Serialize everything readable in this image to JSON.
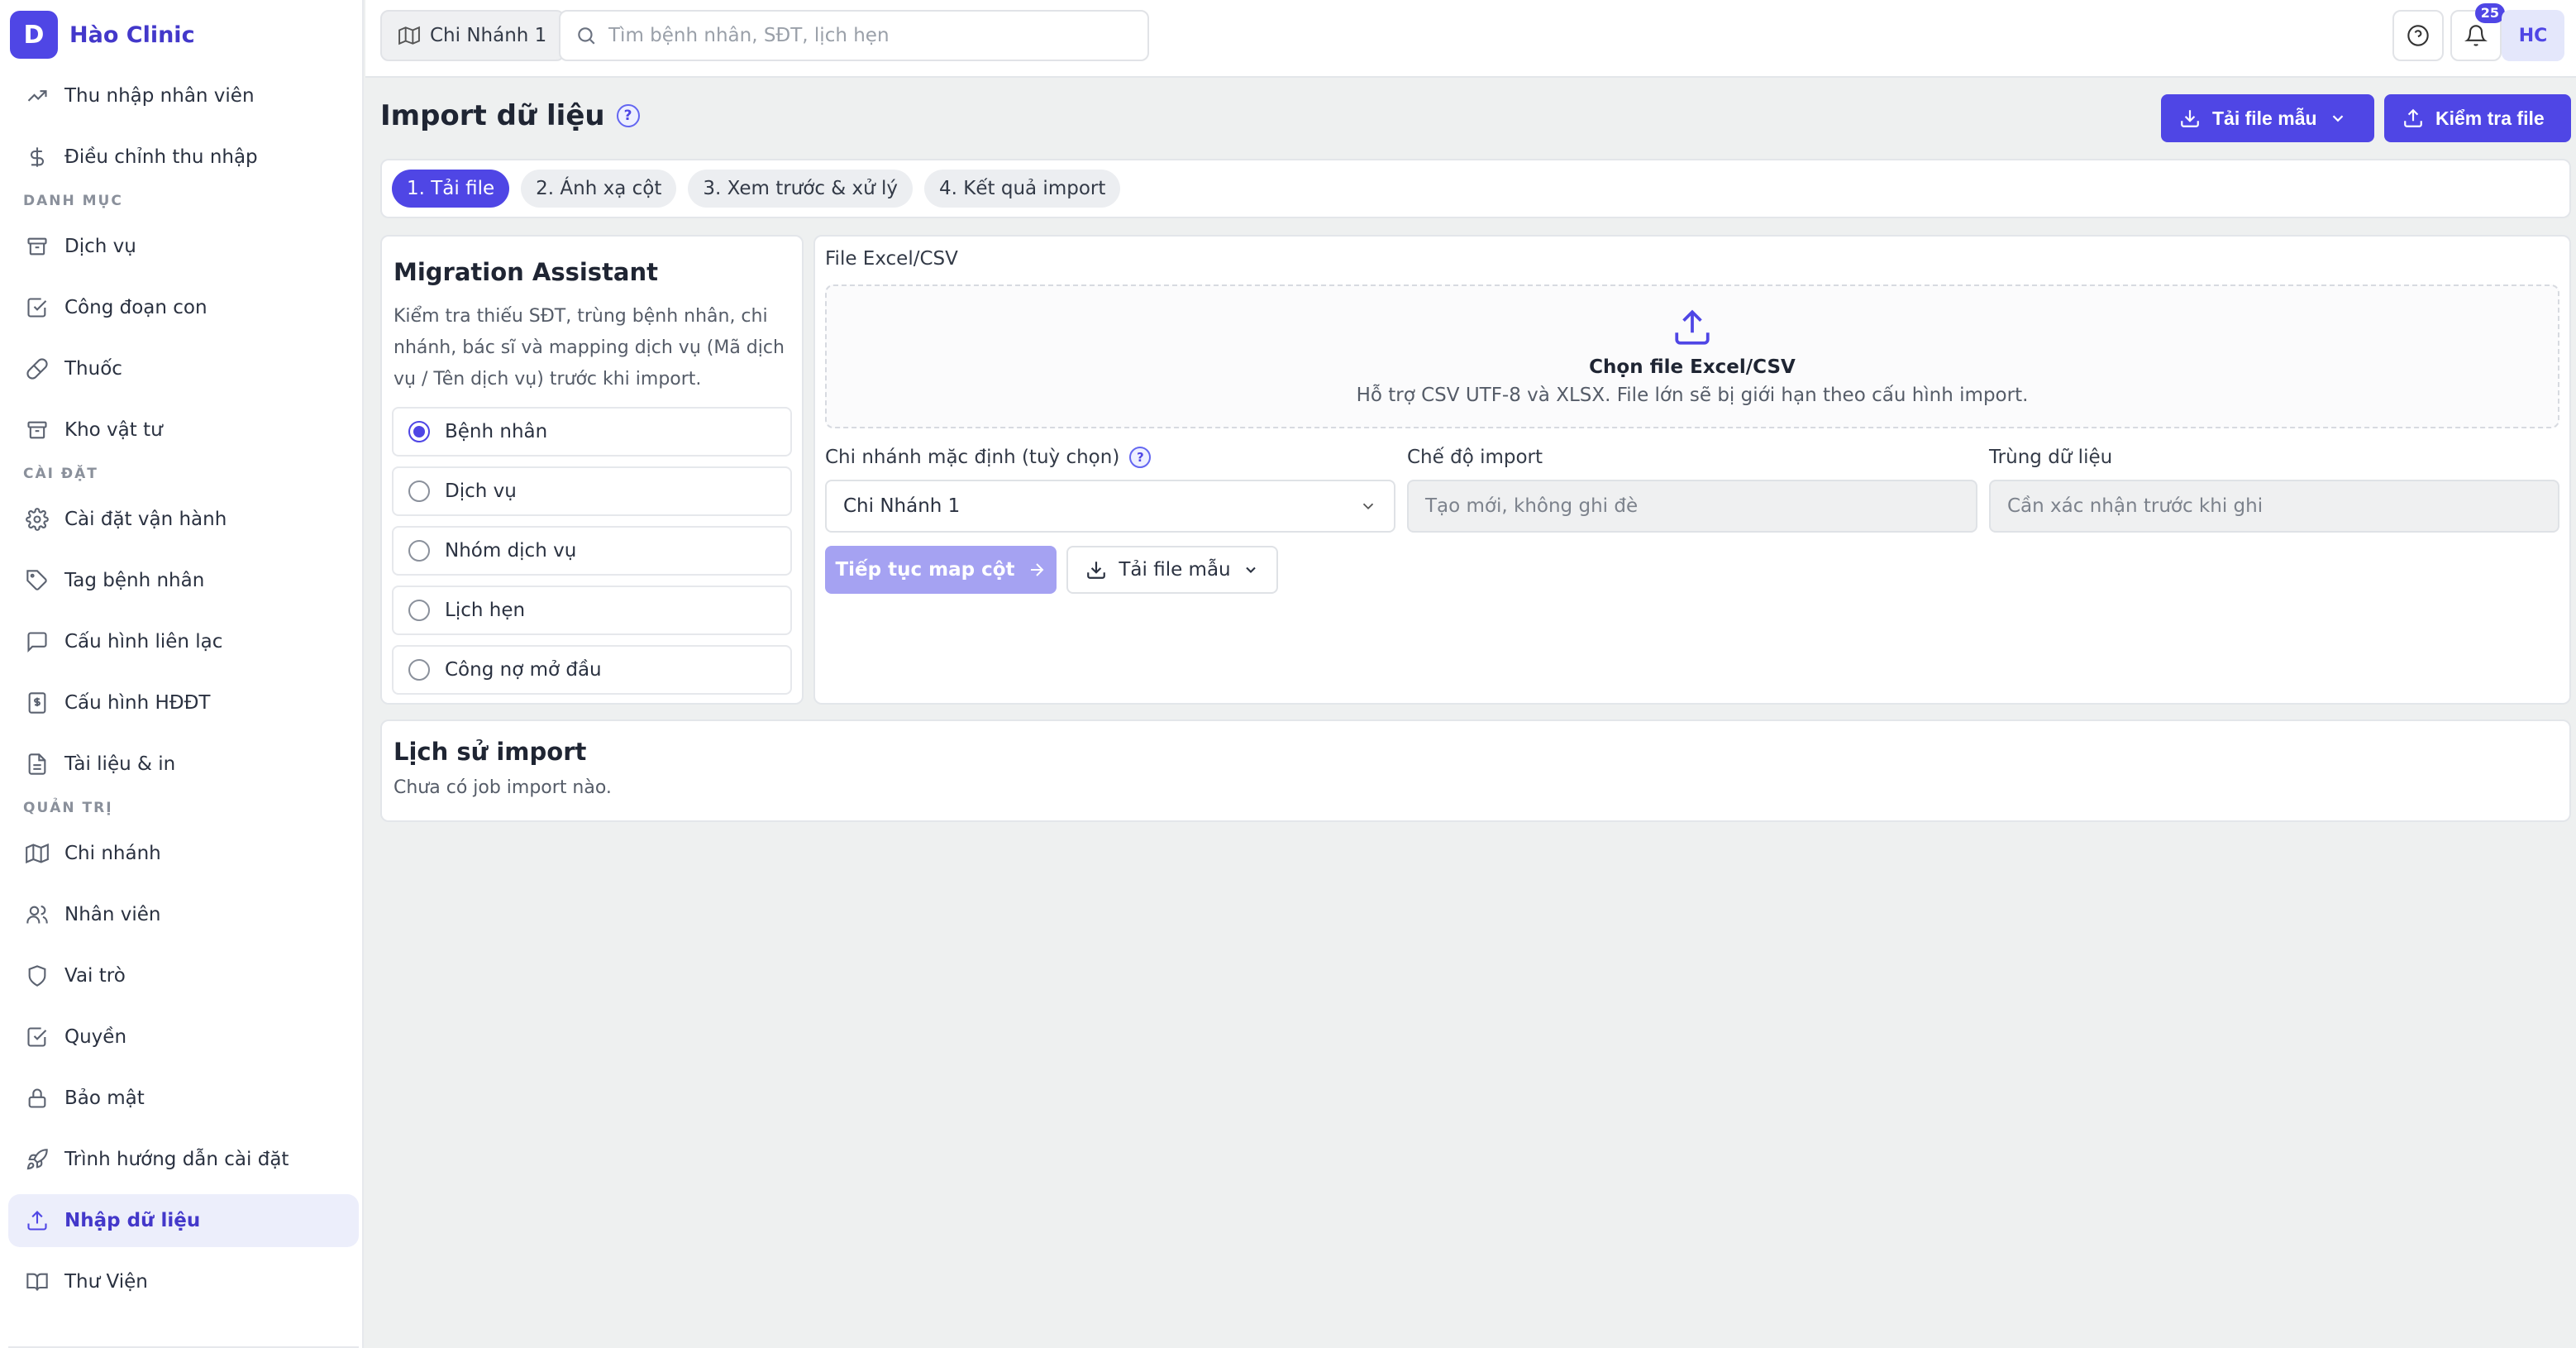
{
  "app": {
    "logo_letter": "D",
    "name": "Hào Clinic"
  },
  "sidebar": {
    "items": [
      {
        "label": "Thu nhập nhân viên",
        "icon": "trending-up-icon"
      },
      {
        "label": "Điều chỉnh thu nhập",
        "icon": "dollar-icon"
      },
      {
        "section": "DANH MỤC"
      },
      {
        "label": "Dịch vụ",
        "icon": "archive-icon"
      },
      {
        "label": "Công đoạn con",
        "icon": "checkbox-icon"
      },
      {
        "label": "Thuốc",
        "icon": "pill-icon"
      },
      {
        "label": "Kho vật tư",
        "icon": "archive-icon"
      },
      {
        "section": "CÀI ĐẶT"
      },
      {
        "label": "Cài đặt vận hành",
        "icon": "gear-icon"
      },
      {
        "label": "Tag bệnh nhân",
        "icon": "tag-icon"
      },
      {
        "label": "Cấu hình liên lạc",
        "icon": "message-icon"
      },
      {
        "label": "Cấu hình HĐĐT",
        "icon": "invoice-icon"
      },
      {
        "label": "Tài liệu & in",
        "icon": "document-icon"
      },
      {
        "section": "QUẢN TRỊ"
      },
      {
        "label": "Chi nhánh",
        "icon": "map-icon"
      },
      {
        "label": "Nhân viên",
        "icon": "users-icon"
      },
      {
        "label": "Vai trò",
        "icon": "shield-icon"
      },
      {
        "label": "Quyền",
        "icon": "checkbox-icon"
      },
      {
        "label": "Bảo mật",
        "icon": "lock-icon"
      },
      {
        "label": "Trình hướng dẫn cài đặt",
        "icon": "rocket-icon"
      },
      {
        "label": "Nhập dữ liệu",
        "icon": "upload-icon",
        "active": true
      },
      {
        "label": "Thư Viện",
        "icon": "book-icon"
      }
    ]
  },
  "topbar": {
    "branch": "Chi Nhánh 1",
    "search_placeholder": "Tìm bệnh nhân, SĐT, lịch hẹn",
    "notification_count": "25",
    "avatar": "HC"
  },
  "page": {
    "title": "Import dữ liệu",
    "help": "?",
    "download_template": "Tải file mẫu",
    "check_file": "Kiểm tra file"
  },
  "steps": [
    "1. Tải file",
    "2. Ánh xạ cột",
    "3. Xem trước & xử lý",
    "4. Kết quả import"
  ],
  "assistant": {
    "title": "Migration Assistant",
    "description": "Kiểm tra thiếu SĐT, trùng bệnh nhân, chi nhánh, bác sĩ và mapping dịch vụ (Mã dịch vụ / Tên dịch vụ) trước khi import.",
    "options": [
      "Bệnh nhân",
      "Dịch vụ",
      "Nhóm dịch vụ",
      "Lịch hẹn",
      "Công nợ mở đầu"
    ],
    "selected": "Bệnh nhân"
  },
  "upload": {
    "label": "File Excel/CSV",
    "choose": "Chọn file Excel/CSV",
    "hint": "Hỗ trợ CSV UTF-8 và XLSX. File lớn sẽ bị giới hạn theo cấu hình import.",
    "branch_label": "Chi nhánh mặc định (tuỳ chọn)",
    "branch_value": "Chi Nhánh 1",
    "mode_label": "Chế độ import",
    "mode_value": "Tạo mới, không ghi đè",
    "dup_label": "Trùng dữ liệu",
    "dup_value": "Cần xác nhận trước khi ghi",
    "continue": "Tiếp tục map cột",
    "download_template": "Tải file mẫu"
  },
  "history": {
    "title": "Lịch sử import",
    "empty": "Chưa có job import nào."
  },
  "colors": {
    "accent": "#4f46e5",
    "accent_disabled": "#a5a2f2",
    "background": "#eef0f0"
  }
}
